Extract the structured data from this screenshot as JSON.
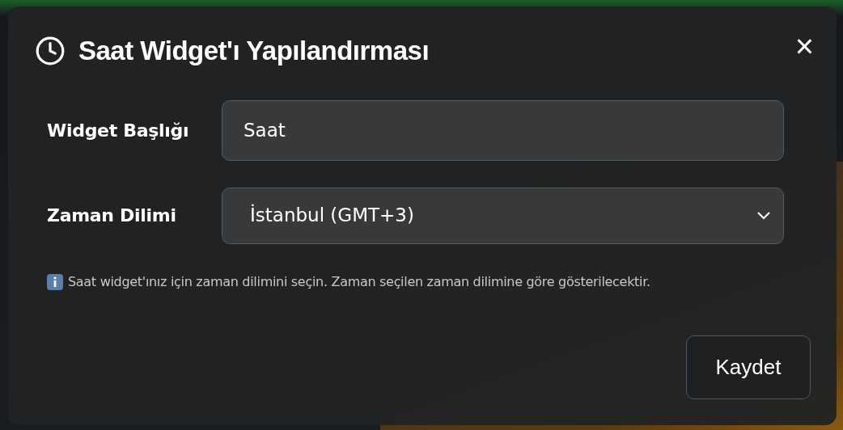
{
  "dialog": {
    "title": "Saat Widget'ı Yapılandırması",
    "close": "×"
  },
  "fields": [
    {
      "kind": "text",
      "label": "Widget Başlığı",
      "value": "Saat"
    },
    {
      "kind": "select",
      "label": "Zaman Dilimi",
      "value": "İstanbul (GMT+3)"
    }
  ],
  "hint": "Saat widget'ınız için zaman dilimini seçin. Zaman seçilen zaman dilimine göre gösterilecektir.",
  "buttons": [
    "Kaydet"
  ]
}
